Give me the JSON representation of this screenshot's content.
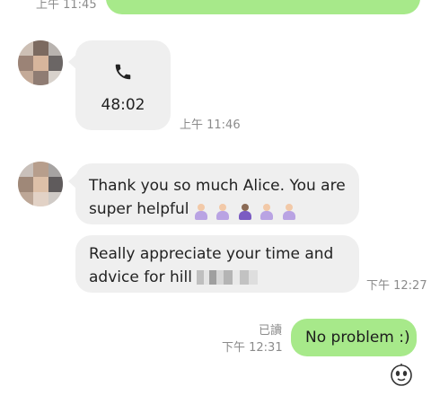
{
  "messages": {
    "top_time": "上午 11:45",
    "call": {
      "duration": "48:02",
      "time": "上午 11:46"
    },
    "incoming": [
      {
        "line1": "Thank you so much Alice. You are",
        "line2": "super helpful"
      },
      {
        "line1": "Really appreciate your time and",
        "line2": "advice for hill",
        "time": "下午 12:27"
      }
    ],
    "outgoing": {
      "read": "已讀",
      "time": "下午 12:31",
      "text": "No problem :)"
    }
  },
  "colors": {
    "incoming_bubble": "#efefef",
    "outgoing_bubble": "#a7e98a",
    "time_text": "#8b8b8b"
  },
  "icons": {
    "call": "phone-icon",
    "sticker": "sticker-face-icon"
  }
}
